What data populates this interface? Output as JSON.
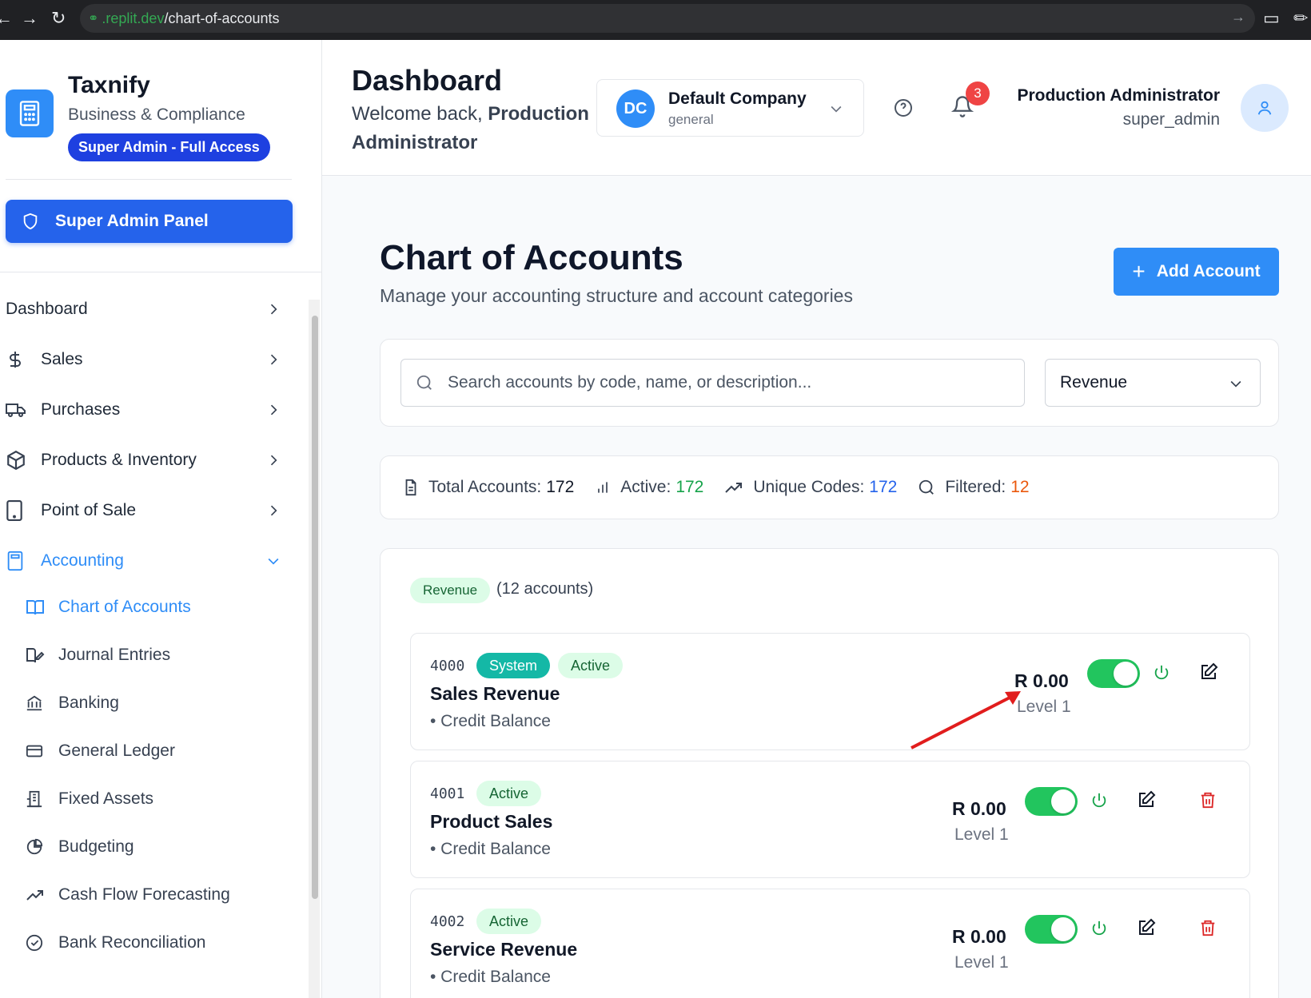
{
  "browser": {
    "url_host": ".replit.dev",
    "url_path": "/chart-of-accounts"
  },
  "sidebar": {
    "brand_name": "Taxnify",
    "brand_subtitle": "Business & Compliance",
    "access_badge": "Super Admin - Full Access",
    "super_admin_panel": "Super Admin Panel",
    "nav": [
      {
        "label": "Dashboard",
        "icon": "none"
      },
      {
        "label": "Sales",
        "icon": "dollar-icon"
      },
      {
        "label": "Purchases",
        "icon": "truck-icon"
      },
      {
        "label": "Products & Inventory",
        "icon": "box-icon"
      },
      {
        "label": "Point of Sale",
        "icon": "tablet-icon"
      },
      {
        "label": "Accounting",
        "icon": "calculator-icon"
      }
    ],
    "accounting_sub": [
      {
        "label": "Chart of Accounts",
        "icon": "book-open-icon"
      },
      {
        "label": "Journal Entries",
        "icon": "notebook-pen-icon"
      },
      {
        "label": "Banking",
        "icon": "bank-icon"
      },
      {
        "label": "General Ledger",
        "icon": "credit-card-icon"
      },
      {
        "label": "Fixed Assets",
        "icon": "building-icon"
      },
      {
        "label": "Budgeting",
        "icon": "pie-chart-icon"
      },
      {
        "label": "Cash Flow Forecasting",
        "icon": "trending-up-icon"
      },
      {
        "label": "Bank Reconciliation",
        "icon": "check-circle-icon"
      }
    ]
  },
  "header": {
    "title": "Dashboard",
    "welcome_prefix": "Welcome back,",
    "welcome_name": "Production Administrator",
    "company_initials": "DC",
    "company_name": "Default Company",
    "company_type": "general",
    "notification_count": "3",
    "user_name": "Production Administrator",
    "user_role": "super_admin"
  },
  "main": {
    "title": "Chart of Accounts",
    "subtitle": "Manage your accounting structure and account categories",
    "add_button": "Add Account",
    "search_placeholder": "Search accounts by code, name, or description...",
    "filter_value": "Revenue",
    "stats": {
      "total_label": "Total Accounts:",
      "total_value": "172",
      "active_label": "Active:",
      "active_value": "172",
      "unique_label": "Unique Codes:",
      "unique_value": "172",
      "filtered_label": "Filtered:",
      "filtered_value": "12"
    },
    "group": {
      "badge": "Revenue",
      "count": "(12 accounts)"
    },
    "accounts": [
      {
        "code": "4000",
        "system_badge": "System",
        "status": "Active",
        "name": "Sales Revenue",
        "balance_type": "• Credit Balance",
        "amount": "R 0.00",
        "level": "Level 1"
      },
      {
        "code": "4001",
        "status": "Active",
        "name": "Product Sales",
        "balance_type": "• Credit Balance",
        "amount": "R 0.00",
        "level": "Level 1"
      },
      {
        "code": "4002",
        "status": "Active",
        "name": "Service Revenue",
        "balance_type": "• Credit Balance",
        "amount": "R 0.00",
        "level": "Level 1"
      }
    ]
  },
  "colors": {
    "primary": "#2f8df7",
    "badge_blue": "#1e40e0",
    "toggle_green": "#22c55e",
    "danger": "#dc2626",
    "annotation_arrow": "#e11d1d"
  }
}
